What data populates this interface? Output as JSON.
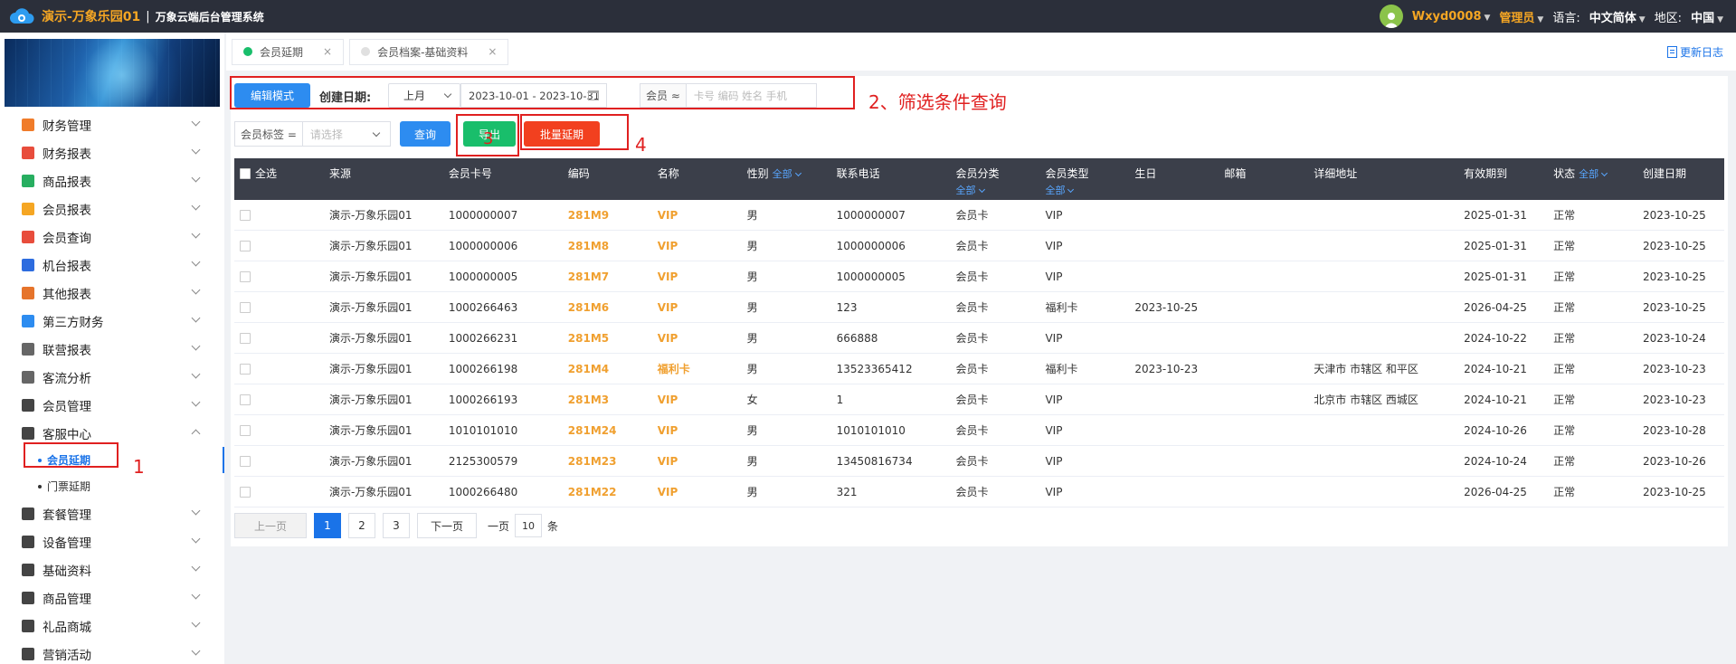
{
  "header": {
    "app_title": "演示-万象乐园01",
    "separator": "|",
    "system_title": "万象云端后台管理系统",
    "username": "Wxyd0008",
    "role": "管理员",
    "language_label": "语言:",
    "language_value": "中文简体",
    "region_label": "地区:",
    "region_value": "中国"
  },
  "sidebar": {
    "items": [
      {
        "label": "财务管理",
        "icon": "finance-icon",
        "color": "#f07c2a"
      },
      {
        "label": "财务报表",
        "icon": "finance-report-icon",
        "color": "#e84d3c"
      },
      {
        "label": "商品报表",
        "icon": "goods-report-icon",
        "color": "#27ae60"
      },
      {
        "label": "会员报表",
        "icon": "member-report-icon",
        "color": "#f5a623"
      },
      {
        "label": "会员查询",
        "icon": "member-query-icon",
        "color": "#e84d3c"
      },
      {
        "label": "机台报表",
        "icon": "machine-report-icon",
        "color": "#2d6cdf"
      },
      {
        "label": "其他报表",
        "icon": "other-report-icon",
        "color": "#e6742b"
      },
      {
        "label": "第三方财务",
        "icon": "third-party-icon",
        "color": "#2d8cf0"
      },
      {
        "label": "联营报表",
        "icon": "joint-report-icon",
        "color": "#666666"
      },
      {
        "label": "客流分析",
        "icon": "traffic-icon",
        "color": "#666666"
      },
      {
        "label": "会员管理",
        "icon": "member-manage-icon",
        "color": "#444444"
      },
      {
        "label": "客服中心",
        "icon": "headset-icon",
        "color": "#444444",
        "expanded": true
      }
    ],
    "sub_items": [
      {
        "label": "会员延期",
        "active": true
      },
      {
        "label": "门票延期",
        "active": false
      }
    ],
    "items_after": [
      {
        "label": "套餐管理",
        "icon": "package-icon",
        "color": "#444444"
      },
      {
        "label": "设备管理",
        "icon": "device-icon",
        "color": "#444444"
      },
      {
        "label": "基础资料",
        "icon": "basic-data-icon",
        "color": "#444444"
      },
      {
        "label": "商品管理",
        "icon": "goods-manage-icon",
        "color": "#444444"
      },
      {
        "label": "礼品商城",
        "icon": "gift-icon",
        "color": "#444444"
      },
      {
        "label": "营销活动",
        "icon": "marketing-icon",
        "color": "#444444"
      }
    ]
  },
  "tabs": [
    {
      "label": "会员延期",
      "dot_color": "#19be6b"
    },
    {
      "label": "会员档案-基础资料",
      "dot_color": "#e0e0e0"
    }
  ],
  "tab_close": "×",
  "changelog": "更新日志",
  "filters": {
    "edit_mode": "编辑模式",
    "create_date_label": "创建日期:",
    "month_value": "上月",
    "date_range": "2023-10-01 - 2023-10-31",
    "member_label": "会员 ≈",
    "member_placeholder": "卡号 编码 姓名 手机",
    "tag_label": "会员标签 =",
    "tag_placeholder": "请选择",
    "query": "查询",
    "export": "导出",
    "batch_extend": "批量延期"
  },
  "annotations": {
    "a1": "1",
    "a2": "2、筛选条件查询",
    "a3": "3",
    "a4": "4"
  },
  "table": {
    "columns": [
      "全选",
      "来源",
      "会员卡号",
      "编码",
      "名称",
      "性别",
      "联系电话",
      "会员分类",
      "会员类型",
      "生日",
      "邮箱",
      "详细地址",
      "有效期到",
      "状态",
      "创建日期"
    ],
    "filter_all": "全部",
    "rows": [
      [
        "",
        "演示-万象乐园01",
        "1000000007",
        "281M9",
        "VIP",
        "男",
        "1000000007",
        "会员卡",
        "VIP",
        "",
        "",
        "",
        "2025-01-31",
        "正常",
        "2023-10-25"
      ],
      [
        "",
        "演示-万象乐园01",
        "1000000006",
        "281M8",
        "VIP",
        "男",
        "1000000006",
        "会员卡",
        "VIP",
        "",
        "",
        "",
        "2025-01-31",
        "正常",
        "2023-10-25"
      ],
      [
        "",
        "演示-万象乐园01",
        "1000000005",
        "281M7",
        "VIP",
        "男",
        "1000000005",
        "会员卡",
        "VIP",
        "",
        "",
        "",
        "2025-01-31",
        "正常",
        "2023-10-25"
      ],
      [
        "",
        "演示-万象乐园01",
        "1000266463",
        "281M6",
        "VIP",
        "男",
        "123",
        "会员卡",
        "福利卡",
        "2023-10-25",
        "",
        "",
        "2026-04-25",
        "正常",
        "2023-10-25"
      ],
      [
        "",
        "演示-万象乐园01",
        "1000266231",
        "281M5",
        "VIP",
        "男",
        "666888",
        "会员卡",
        "VIP",
        "",
        "",
        "",
        "2024-10-22",
        "正常",
        "2023-10-24"
      ],
      [
        "",
        "演示-万象乐园01",
        "1000266198",
        "281M4",
        "福利卡",
        "男",
        "13523365412",
        "会员卡",
        "福利卡",
        "2023-10-23",
        "",
        "天津市 市辖区 和平区",
        "2024-10-21",
        "正常",
        "2023-10-23"
      ],
      [
        "",
        "演示-万象乐园01",
        "1000266193",
        "281M3",
        "VIP",
        "女",
        "1",
        "会员卡",
        "VIP",
        "",
        "",
        "北京市 市辖区 西城区",
        "2024-10-21",
        "正常",
        "2023-10-23"
      ],
      [
        "",
        "演示-万象乐园01",
        "1010101010",
        "281M24",
        "VIP",
        "男",
        "1010101010",
        "会员卡",
        "VIP",
        "",
        "",
        "",
        "2024-10-26",
        "正常",
        "2023-10-28"
      ],
      [
        "",
        "演示-万象乐园01",
        "2125300579",
        "281M23",
        "VIP",
        "男",
        "13450816734",
        "会员卡",
        "VIP",
        "",
        "",
        "",
        "2024-10-24",
        "正常",
        "2023-10-26"
      ],
      [
        "",
        "演示-万象乐园01",
        "1000266480",
        "281M22",
        "VIP",
        "男",
        "321",
        "会员卡",
        "VIP",
        "",
        "",
        "",
        "2026-04-25",
        "正常",
        "2023-10-25"
      ]
    ]
  },
  "pagination": {
    "prev": "上一页",
    "pages": [
      "1",
      "2",
      "3"
    ],
    "current": "1",
    "next": "下一页",
    "per_page_label": "一页",
    "per_page_value": "10",
    "per_page_unit": "条"
  },
  "colors": {
    "primary": "#2d8cf0",
    "success": "#19be6b",
    "danger": "#f2401f",
    "accent": "#f5a623",
    "annotation": "#e02020"
  }
}
